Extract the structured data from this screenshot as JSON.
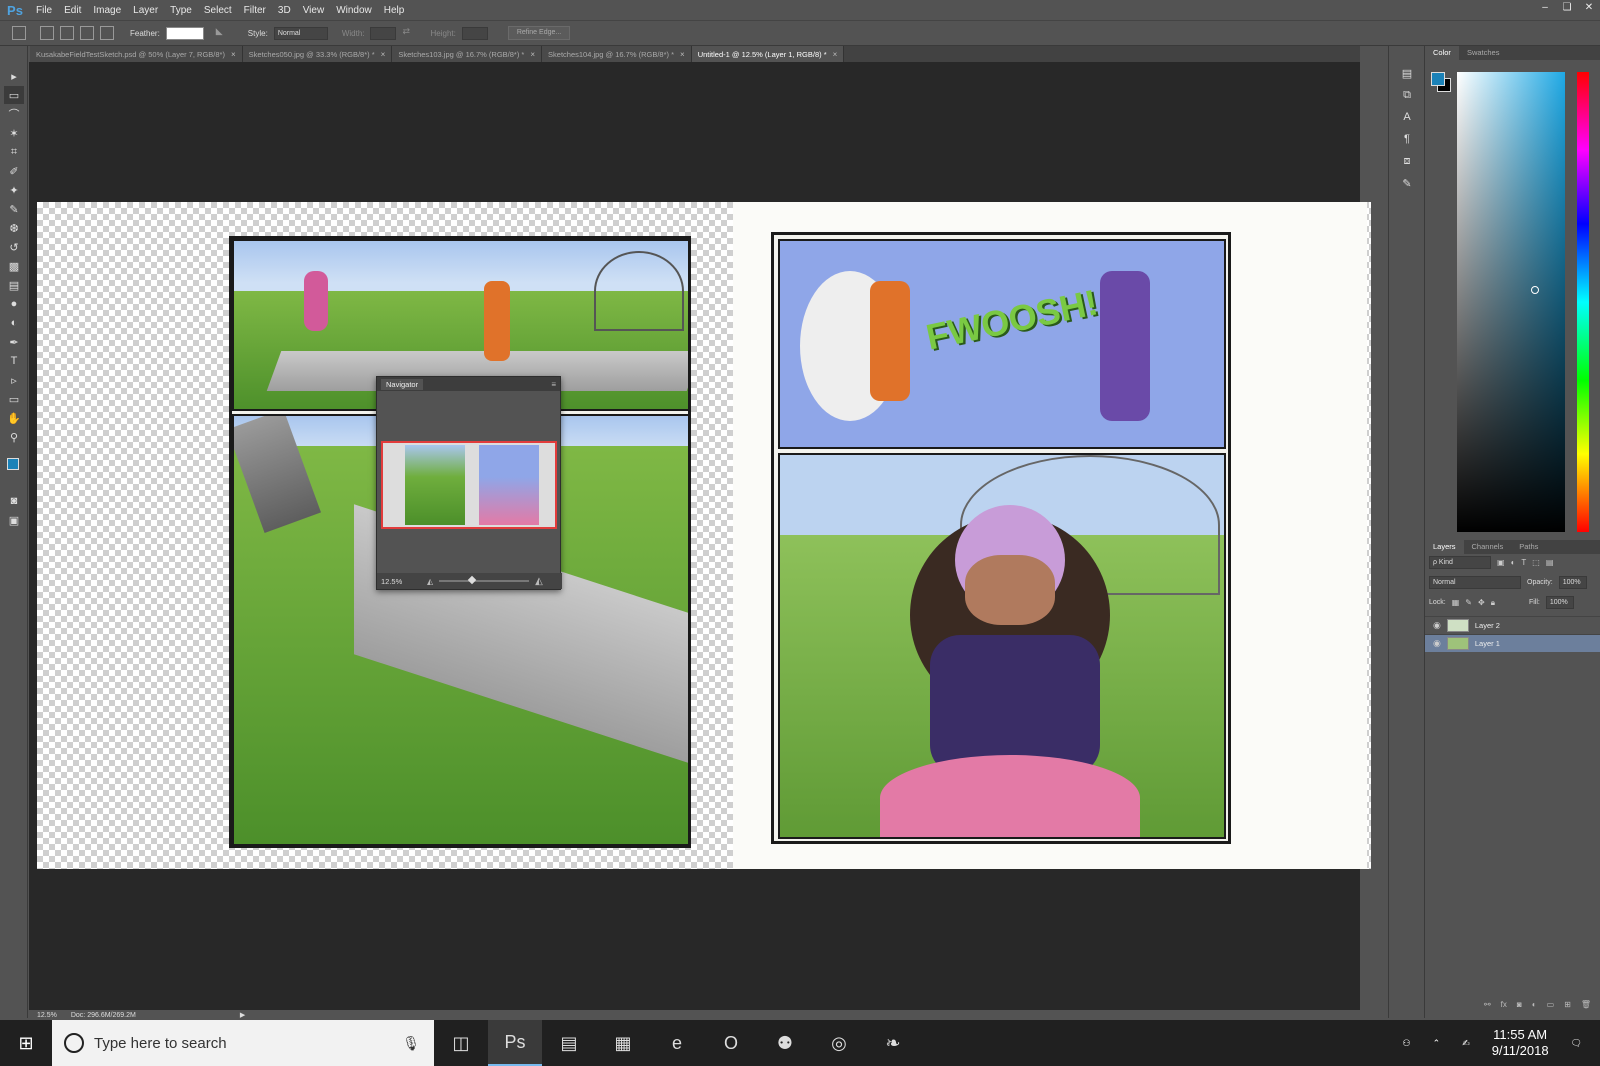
{
  "app": {
    "logo": "Ps"
  },
  "menu": [
    "File",
    "Edit",
    "Image",
    "Layer",
    "Type",
    "Select",
    "Filter",
    "3D",
    "View",
    "Window",
    "Help"
  ],
  "window_controls": {
    "minimize": "–",
    "restore": "❏",
    "close": "✕"
  },
  "options_bar": {
    "feather_label": "Feather:",
    "feather_value": "",
    "style_label": "Style:",
    "style_value": "Normal",
    "width_label": "Width:",
    "height_label": "Height:",
    "refine_edge": "Refine Edge..."
  },
  "tabs": [
    {
      "label": "KusakabeFieldTestSketch.psd @ 50% (Layer 7, RGB/8*)",
      "close": "×"
    },
    {
      "label": "Sketches050.jpg @ 33.3% (RGB/8*) *",
      "close": "×"
    },
    {
      "label": "Sketches103.jpg @ 16.7% (RGB/8*) *",
      "close": "×"
    },
    {
      "label": "Sketches104.jpg @ 16.7% (RGB/8*) *",
      "close": "×"
    },
    {
      "label": "Untitled-1 @ 12.5% (Layer 1, RGB/8) *",
      "close": "×",
      "active": true
    }
  ],
  "tools": [
    "move-tool",
    "marquee-tool",
    "lasso-tool",
    "quick-select-tool",
    "crop-tool",
    "eyedropper-tool",
    "spot-heal-tool",
    "brush-tool",
    "stamp-tool",
    "history-brush-tool",
    "eraser-tool",
    "gradient-tool",
    "blur-tool",
    "dodge-tool",
    "pen-tool",
    "type-tool",
    "path-select-tool",
    "shape-tool",
    "hand-tool",
    "zoom-tool"
  ],
  "tool_glyphs": [
    "▸",
    "▭",
    "⌒",
    "✶",
    "⌗",
    "✐",
    "✦",
    "✎",
    "❆",
    "↺",
    "▩",
    "▤",
    "●",
    "◐",
    "✒",
    "T",
    "▹",
    "▭",
    "✋",
    "⚲"
  ],
  "comic": {
    "sfx": "FWOOSH!"
  },
  "navigator": {
    "title": "Navigator",
    "zoom": "12.5%"
  },
  "panels": {
    "color_tabs": [
      "Color",
      "Swatches"
    ],
    "foreground_color": "#1b82b8",
    "background_color": "#000000",
    "layers_tabs": [
      "Layers",
      "Channels",
      "Paths"
    ],
    "kind_label": "ρ Kind",
    "blend_mode": "Normal",
    "opacity_label": "Opacity:",
    "opacity_value": "100%",
    "lock_label": "Lock:",
    "fill_label": "Fill:",
    "fill_value": "100%",
    "layers": [
      {
        "name": "Layer 2",
        "visible": true,
        "selected": false
      },
      {
        "name": "Layer 1",
        "visible": true,
        "selected": true
      }
    ],
    "visibility_icon": "◉"
  },
  "status": {
    "zoom": "12.5%",
    "doc": "Doc: 296.6M/269.2M"
  },
  "taskbar": {
    "search_placeholder": "Type here to search",
    "time": "11:55 AM",
    "date": "9/11/2018",
    "apps": [
      {
        "name": "task-view",
        "glyph": "◫"
      },
      {
        "name": "photoshop",
        "glyph": "Ps",
        "active": true
      },
      {
        "name": "file-explorer",
        "glyph": "▤"
      },
      {
        "name": "store",
        "glyph": "▦"
      },
      {
        "name": "edge",
        "glyph": "e"
      },
      {
        "name": "opera",
        "glyph": "O"
      },
      {
        "name": "discord",
        "glyph": "⚉"
      },
      {
        "name": "chrome",
        "glyph": "◎"
      },
      {
        "name": "app-extra",
        "glyph": "❧"
      }
    ]
  }
}
